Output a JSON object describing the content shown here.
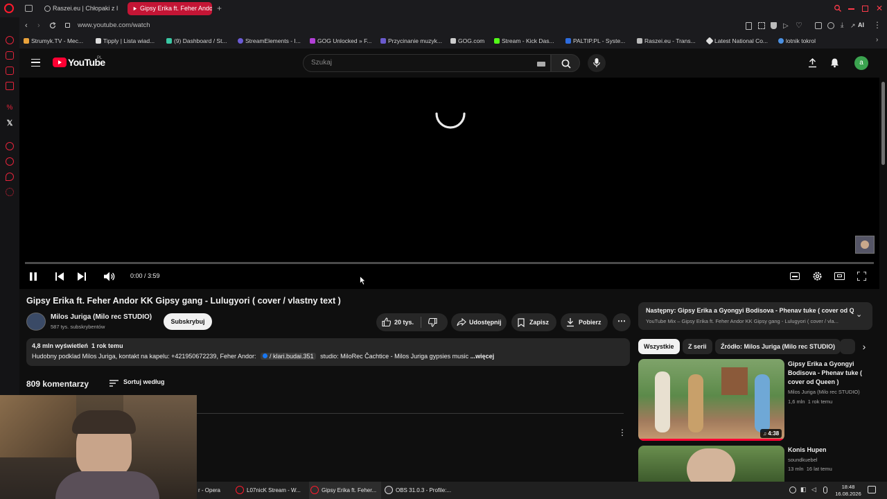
{
  "browser": {
    "tabs": [
      {
        "label": "Raszei.eu | Chłopaki z I",
        "active": false
      },
      {
        "label": "Gipsy Erika ft. Feher Andor",
        "active": true
      }
    ],
    "new_tab": "+",
    "url": "www.youtube.com/watch",
    "bookmarks": [
      "Strumyk.TV - Mec...",
      "Tipply | Lista wiad...",
      "(9) Dashboard / St...",
      "StreamElements - I...",
      "GOG Unlocked » F...",
      "Przycinanie muzyk...",
      "GOG.com",
      "Stream - Kick Das...",
      "PALTIP.PL - Syste...",
      "Raszei.eu - Trans...",
      "Latest National Co...",
      "lotnik tokrol"
    ],
    "aria_label": "AI"
  },
  "youtube": {
    "logo_text": "YouTube",
    "logo_region": "PL",
    "search_placeholder": "Szukaj",
    "avatar_letter": "a",
    "player": {
      "time": "0:00 / 3:59",
      "progress": 0
    },
    "video": {
      "title": "Gipsy Erika ft. Feher Andor KK Gipsy gang - Lulugyori ( cover / vlastny text )",
      "channel": "Milos Juriga (Milo rec STUDIO)",
      "subscribers": "587 tys. subskrybentów",
      "subscribe_label": "Subskrybuj",
      "likes": "20 tys.",
      "share_label": "Udostępnij",
      "save_label": "Zapisz",
      "download_label": "Pobierz",
      "views": "4,8 mln wyświetleń",
      "age": "1 rok temu",
      "description_prefix": "Hudobny podklad Milos Juriga, kontakt na kapelu: +421950672239, Feher Andor:",
      "description_link": "/ klari.budai.351",
      "description_suffix": "studio: MiloRec Čachtice - Milos Juriga gypsies music",
      "more_label": "...więcej"
    },
    "comments": {
      "count": "809 komentarzy",
      "sort_label": "Sortuj według"
    },
    "sidebar": {
      "next_title": "Następny: Gipsy Erika a Gyongyi Bodisova - Phenav tuke ( cover od Q...",
      "next_sub": "YouTube Mix – Gipsy Erika ft. Feher Andor KK Gipsy gang - Lulugyori ( cover / vla...",
      "chips": [
        "Wszystkie",
        "Z serii",
        "Źródło: Milos Juriga (Milo rec STUDIO)"
      ],
      "items": [
        {
          "title": "Gipsy Erika a Gyongyi Bodisova - Phenav tuke ( cover od Queen )",
          "channel": "Milos Juriga (Milo rec STUDIO)",
          "views": "1,6 mln",
          "age": "1 rok temu",
          "duration": "4:38",
          "watched": 1.0
        },
        {
          "title": "Konis Hupen",
          "channel": "soundkuebel",
          "views": "13 mln",
          "age": "16 lat temu",
          "duration": "",
          "watched": 0
        }
      ]
    }
  },
  "taskbar": {
    "items": [
      "r - Opera",
      "L07nicK Stream - W...",
      "Gipsy Erika ft. Feher...",
      "OBS 31.0.3 - Profile:..."
    ],
    "time": "18:48",
    "date": "16.08.2026"
  },
  "colors": {
    "youtube_red": "#ff0033",
    "opera_red": "#ff1b2d",
    "active_tab": "#c41535",
    "background": "#0f0f0f",
    "avatar_green": "#3ba34f"
  }
}
